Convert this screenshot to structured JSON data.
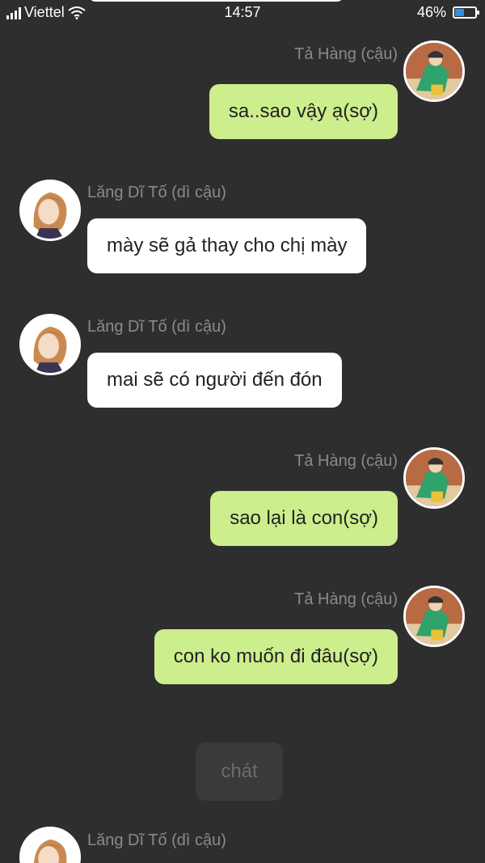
{
  "status_bar": {
    "carrier": "Viettel",
    "time": "14:57",
    "battery_percent": "46%",
    "battery_level": 0.46
  },
  "characters": {
    "self": {
      "name": "Tả Hàng (cậu)",
      "bubble_color": "#cdee8d",
      "avatar_icon": "boy-avatar-icon"
    },
    "aunt": {
      "name": "Lăng Dĩ Tố (dì cậu)",
      "bubble_color": "#ffffff",
      "avatar_icon": "woman-avatar-icon"
    }
  },
  "messages": [
    {
      "sender": "Tả Hàng (cậu)",
      "text": "sa..sao vậy ạ(sợ)"
    },
    {
      "sender": "Lăng Dĩ Tố (dì cậu)",
      "text": "mày sẽ gả thay cho chị mày"
    },
    {
      "sender": "Lăng Dĩ Tố (dì cậu)",
      "text": "mai sẽ có người đến đón"
    },
    {
      "sender": "Tả Hàng (cậu)",
      "text": "sao lại là con(sợ)"
    },
    {
      "sender": "Tả Hàng (cậu)",
      "text": "con ko muốn đi đâu(sợ)"
    },
    {
      "sender": "Lăng Dĩ Tố (dì cậu)",
      "text": ""
    }
  ],
  "system_message": "chát",
  "colors": {
    "background": "#2e2e2e",
    "name_text": "#8a8a8a"
  }
}
